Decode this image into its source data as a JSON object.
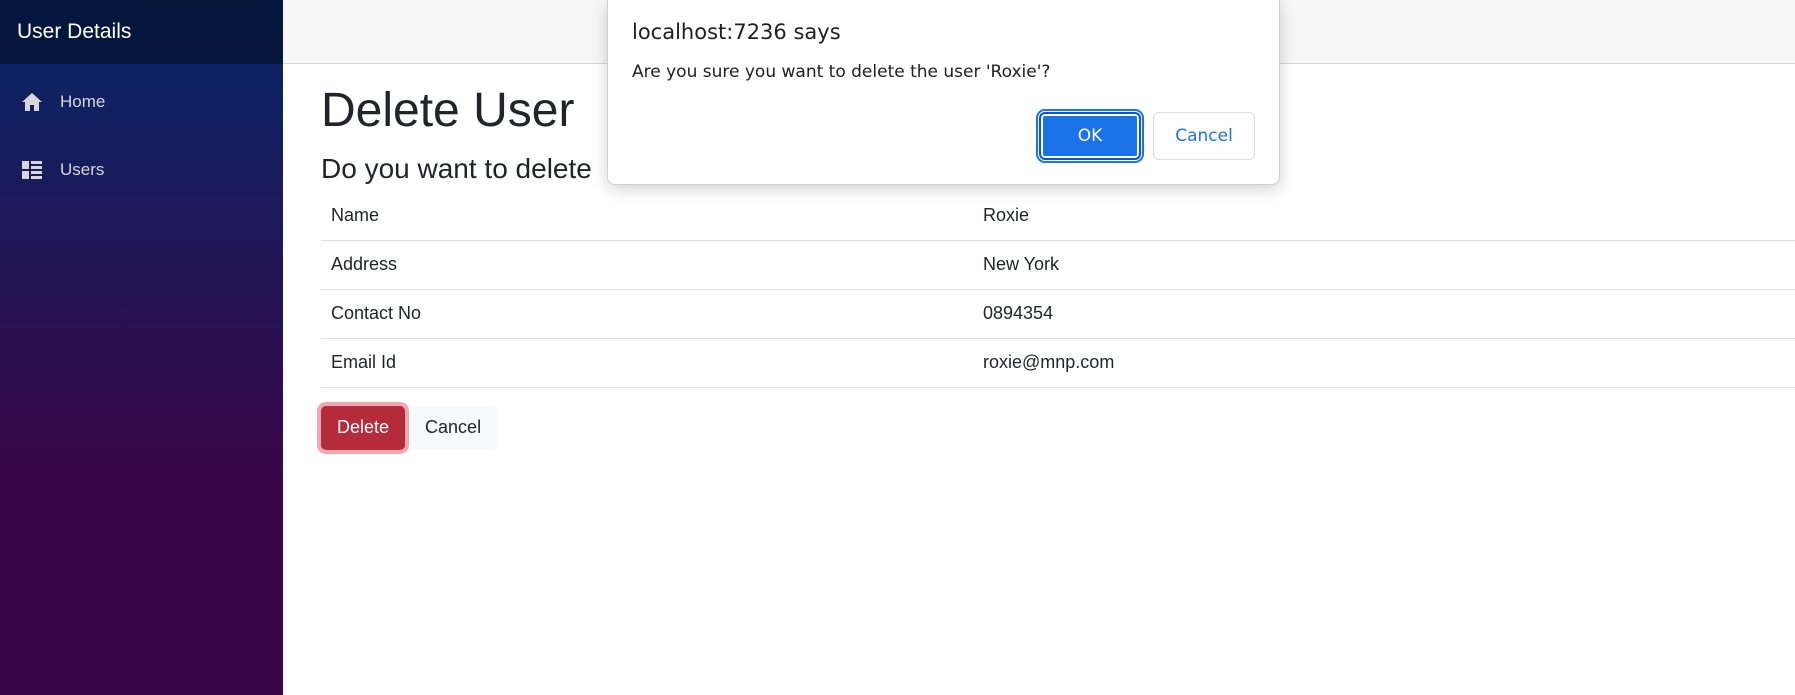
{
  "sidebar": {
    "brand": "User Details",
    "items": [
      {
        "label": "Home",
        "icon": "home-icon"
      },
      {
        "label": "Users",
        "icon": "list-icon"
      }
    ]
  },
  "main": {
    "title": "Delete User",
    "subtitle": "Do you want to delete",
    "details": [
      {
        "label": "Name",
        "value": "Roxie"
      },
      {
        "label": "Address",
        "value": "New York"
      },
      {
        "label": "Contact No",
        "value": "0894354"
      },
      {
        "label": "Email Id",
        "value": "roxie@mnp.com"
      }
    ],
    "delete_label": "Delete",
    "cancel_label": "Cancel"
  },
  "dialog": {
    "title": "localhost:7236 says",
    "message": "Are you sure you want to delete the user 'Roxie'?",
    "ok_label": "OK",
    "cancel_label": "Cancel"
  },
  "colors": {
    "danger": "#b52b3b",
    "dialog_primary": "#1a73e8"
  }
}
